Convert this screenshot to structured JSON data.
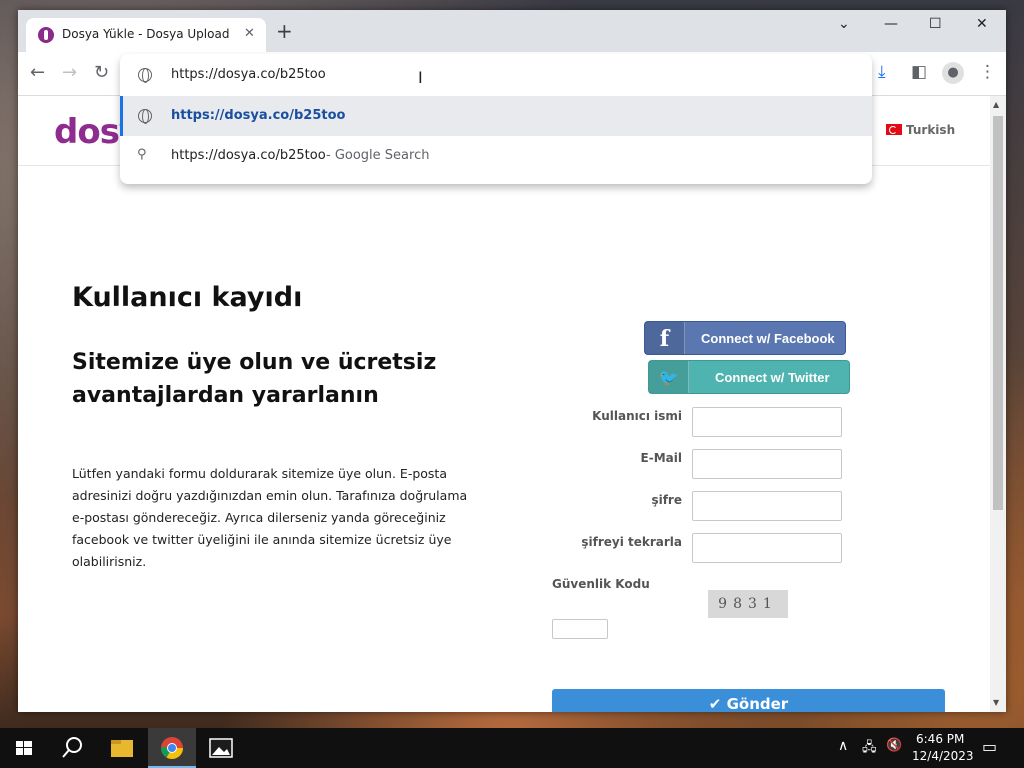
{
  "browser": {
    "tab": {
      "title": "Dosya Yükle - Dosya Upload",
      "close": "✕"
    },
    "new_tab": "+",
    "window_controls": {
      "dropdown": "⌄",
      "minimize": "—",
      "maximize": "☐",
      "close": "✕"
    },
    "nav": {
      "back": "←",
      "forward": "→",
      "reload": "↻"
    },
    "omnibox": {
      "value": "https://dosya.co/b25too",
      "suggestions": [
        {
          "icon": "globe-icon",
          "text": "https://dosya.co/b25too",
          "suffix": ""
        },
        {
          "icon": "search-icon",
          "text": "https://dosya.co/b25too",
          "suffix": " - Google Search"
        }
      ]
    },
    "toolbar_icons": {
      "download": "⤓",
      "sidepanel": "◧",
      "profile": "●",
      "menu": "⋮"
    }
  },
  "site": {
    "logo": "dosya",
    "language": "Turkish"
  },
  "main": {
    "heading": "Kullanıcı kayıdı",
    "subheading": "Sitemize üye olun ve ücretsiz avantajlardan yararlanın",
    "description": "Lütfen yandaki formu doldurarak sitemize üye olun. E-posta adresinizi doğru yazdığınızdan emin olun. Tarafınıza doğrulama e-postası göndereceğiz. Ayrıca dilerseniz yanda göreceğiniz facebook ve twitter üyeliğini ile anında sitemize ücretsiz üye olabilirisniz."
  },
  "form": {
    "facebook": {
      "icon": "f",
      "label": "Connect w/ Facebook"
    },
    "twitter": {
      "icon": "🐦",
      "label": "Connect w/ Twitter"
    },
    "username_label": "Kullanıcı ismi",
    "email_label": "E-Mail",
    "password_label": "şifre",
    "password_repeat_label": "şifreyi tekrarla",
    "captcha_label": "Güvenlik Kodu",
    "captcha_code": "9831",
    "submit_label": "✔ Gönder"
  },
  "taskbar": {
    "time": "6:46 PM",
    "date": "12/4/2023"
  },
  "colors": {
    "brand": "#8e2c8f",
    "facebook": "#5b77b2",
    "twitter": "#4fb4b0",
    "submit": "#3a8fd8",
    "omnibox_highlight": "#1a73e8"
  }
}
